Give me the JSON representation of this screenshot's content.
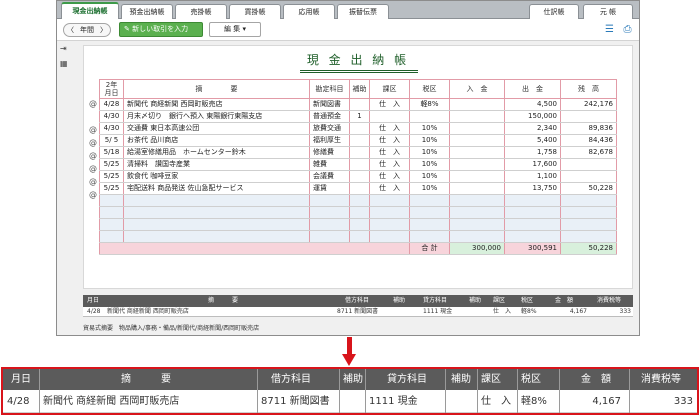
{
  "tabs": [
    {
      "label": "現金出納帳",
      "active": true
    },
    {
      "label": "預金出納帳"
    },
    {
      "label": "売掛帳"
    },
    {
      "label": "買掛帳"
    },
    {
      "label": "応用帳"
    },
    {
      "label": "振替伝票"
    }
  ],
  "right_tabs": [
    {
      "label": "仕訳帳"
    },
    {
      "label": "元 帳"
    }
  ],
  "toolbar": {
    "prev": "〈",
    "period": "年間",
    "next": "〉",
    "new_entry": "新しい取引を入力",
    "edit": "編 集",
    "edit_icon": "✎",
    "dropdown_icon": "▾",
    "list_icon": "☰",
    "print_icon": "⎙"
  },
  "ledger": {
    "title": "現 金 出 納 帳",
    "headers": {
      "date_year": "2年",
      "date_month": "月日",
      "description": "摘　　　　要",
      "account": "勘定科目",
      "sub": "補助",
      "tax_type": "課区",
      "tax_rate": "税区",
      "income": "入　金",
      "expense": "出　金",
      "balance": "残　高"
    },
    "rows": [
      {
        "clip": "@",
        "date": "4/28",
        "desc": "新聞代 商経新聞 西岡町販売店",
        "account": "新聞図書",
        "sub": "",
        "tax_type": "仕　入",
        "tax_rate": "軽8%",
        "income": "",
        "expense": "4,500",
        "balance": "242,176"
      },
      {
        "clip": "",
        "date": "4/30",
        "desc": "月末〆切り　銀行へ預入 東陽銀行東陽支店",
        "account": "普通預金",
        "sub": "1",
        "tax_type": "",
        "tax_rate": "",
        "income": "",
        "expense": "150,000",
        "balance": ""
      },
      {
        "clip": "@",
        "date": "4/30",
        "desc": "交通費 東日本高速公団",
        "account": "旅費交通",
        "sub": "",
        "tax_type": "仕　入",
        "tax_rate": "10%",
        "income": "",
        "expense": "2,340",
        "balance": "89,836"
      },
      {
        "clip": "@",
        "date": "5/ 5",
        "desc": "お茶代 品川商店",
        "account": "福利厚生",
        "sub": "",
        "tax_type": "仕　入",
        "tax_rate": "10%",
        "income": "",
        "expense": "5,400",
        "balance": "84,436"
      },
      {
        "clip": "@",
        "date": "5/18",
        "desc": "給湯室修繕用品　ホームセンター鈴木",
        "account": "修繕費",
        "sub": "",
        "tax_type": "仕　入",
        "tax_rate": "10%",
        "income": "",
        "expense": "1,758",
        "balance": "82,678"
      },
      {
        "clip": "@",
        "date": "5/25",
        "desc": "清掃料　讃国寺産業",
        "account": "雑費",
        "sub": "",
        "tax_type": "仕　入",
        "tax_rate": "10%",
        "income": "",
        "expense": "17,600",
        "balance": ""
      },
      {
        "clip": "@",
        "date": "5/25",
        "desc": "飲食代 咖啡豆家",
        "account": "会議費",
        "sub": "",
        "tax_type": "仕　入",
        "tax_rate": "10%",
        "income": "",
        "expense": "1,100",
        "balance": ""
      },
      {
        "clip": "@",
        "date": "5/25",
        "desc": "宅配送料 商品発送 佐山急配サービス",
        "account": "運賃",
        "sub": "",
        "tax_type": "仕　入",
        "tax_rate": "10%",
        "income": "",
        "expense": "13,750",
        "balance": "50,228"
      }
    ],
    "total": {
      "label": "合 計",
      "income": "300,000",
      "expense": "300,591",
      "balance": "50,228"
    }
  },
  "detail": {
    "headers": {
      "date": "月日",
      "desc": "摘　　　要",
      "debit": "借方科目",
      "sub1": "補助",
      "credit": "貸方科目",
      "sub2": "補助",
      "tax_type": "課区",
      "tax_rate": "税区",
      "amount": "金　額",
      "tax": "消費税等"
    },
    "row": {
      "date": "4/28",
      "desc": "新聞代 商経新聞 西岡町販売店",
      "debit": "8711 新聞図書",
      "sub1": "",
      "credit": "1111 現金",
      "sub2": "",
      "tax_type": "仕　入",
      "tax_rate": "軽8%",
      "amount": "4,167",
      "tax": "333"
    },
    "status": "貿易式摘要　物品購入/事務・備品/新聞代/商経新聞/西岡町販売店"
  },
  "zoom": {
    "headers": {
      "date": "月日",
      "desc": "摘　　　要",
      "debit": "借方科目",
      "sub1": "補助",
      "credit": "貸方科目",
      "sub2": "補助",
      "tax_type": "課区",
      "tax_rate": "税区",
      "amount": "金　額",
      "tax": "消費税等"
    },
    "row": {
      "date": "4/28",
      "desc": "新聞代 商経新聞 西岡町販売店",
      "debit": "8711 新聞図書",
      "sub1": "",
      "credit": "1111 現金",
      "sub2": "",
      "tax_type": "仕　入",
      "tax_rate": "軽8%",
      "amount": "4,167",
      "tax": "333"
    }
  },
  "colors": {
    "accent": "#3d9a49",
    "arrow": "#d8141b",
    "grid": "#e29ba7",
    "detail_header": "#5b5b5b"
  },
  "icons": {
    "ledger_clip": "paperclip-icon",
    "side_top": "export-icon",
    "side_bottom": "grid-icon"
  }
}
